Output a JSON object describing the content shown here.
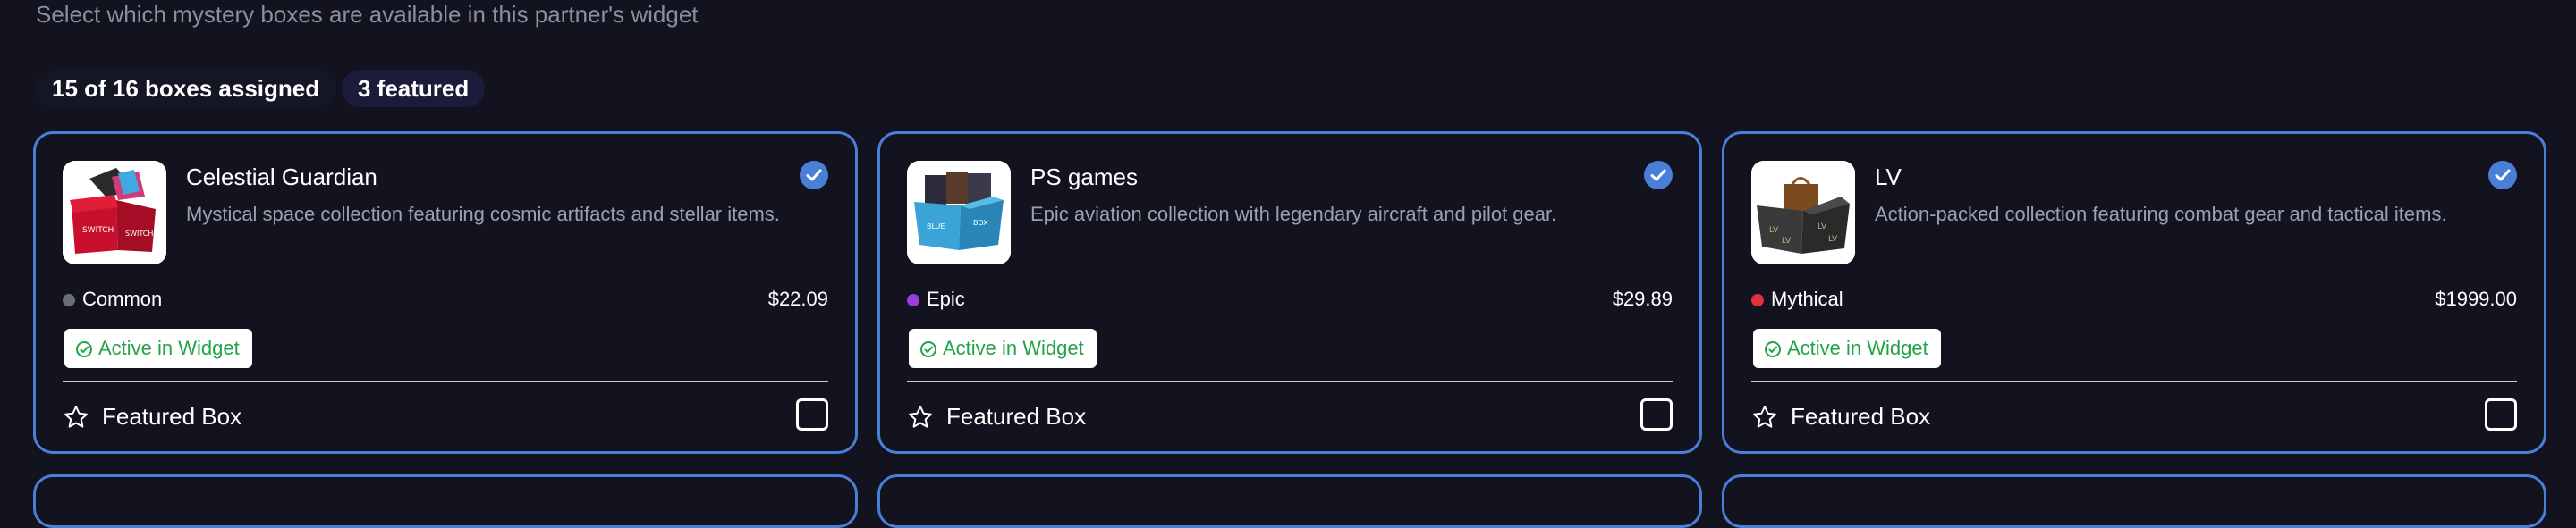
{
  "header": {
    "subtitle": "Select which mystery boxes are available in this partner's widget",
    "assigned_count": "15 of 16 boxes assigned",
    "featured_count": "3 featured"
  },
  "cards": [
    {
      "title": "Celestial Guardian",
      "description": "Mystical space collection featuring cosmic artifacts and stellar items.",
      "rarity": "Common",
      "rarity_color": "#6b6e78",
      "price": "$22.09",
      "status": "Active in Widget",
      "featured_label": "Featured Box",
      "selected": true,
      "featured": false
    },
    {
      "title": "PS games",
      "description": "Epic aviation collection with legendary aircraft and pilot gear.",
      "rarity": "Epic",
      "rarity_color": "#9b3de0",
      "price": "$29.89",
      "status": "Active in Widget",
      "featured_label": "Featured Box",
      "selected": true,
      "featured": false
    },
    {
      "title": "LV",
      "description": "Action-packed collection featuring combat gear and tactical items.",
      "rarity": "Mythical",
      "rarity_color": "#e0323a",
      "price": "$1999.00",
      "status": "Active in Widget",
      "featured_label": "Featured Box",
      "selected": true,
      "featured": false
    }
  ],
  "colors": {
    "background": "#12131f",
    "accent": "#4a7fd8",
    "active_green": "#22a447"
  }
}
